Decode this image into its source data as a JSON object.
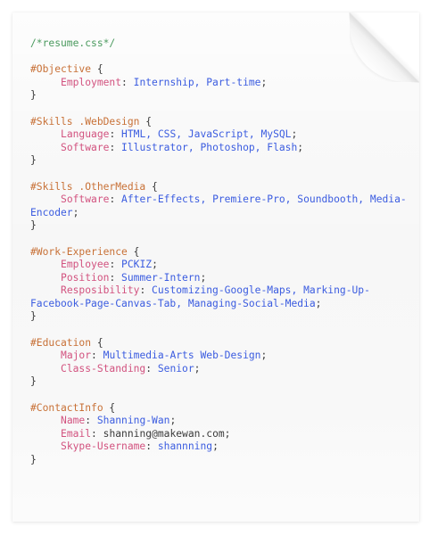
{
  "document": {
    "kind": "css-resume-page",
    "colors": {
      "page_background": "#f7f7f7",
      "canvas_background": "#ffffff",
      "comment": "#4a9a5e",
      "selector": "#c87137",
      "property": "#d2527f",
      "value": "#3b5ce0",
      "punctuation": "#3a3a3a"
    },
    "comment": "/*resume.css*/",
    "open_brace": "{",
    "close_brace": "}",
    "colon": ": ",
    "semicolon": ";",
    "rules": [
      {
        "selector": "#Objective",
        "declarations": [
          {
            "property": "Employment",
            "value": "Internship, Part-time",
            "value_style": "value"
          }
        ]
      },
      {
        "selector": "#Skills .WebDesign",
        "declarations": [
          {
            "property": "Language",
            "value": "HTML, CSS, JavaScript, MySQL",
            "value_style": "value"
          },
          {
            "property": "Software",
            "value": "Illustrator, Photoshop, Flash",
            "value_style": "value"
          }
        ]
      },
      {
        "selector": "#Skills .OtherMedia",
        "declarations": [
          {
            "property": "Software",
            "value": "After-Effects, Premiere-Pro, Soundbooth, Media-Encoder",
            "value_style": "value"
          }
        ]
      },
      {
        "selector": "#Work-Experience",
        "declarations": [
          {
            "property": "Employee",
            "value": "PCKIZ",
            "value_style": "value"
          },
          {
            "property": "Position",
            "value": "Summer-Intern",
            "value_style": "value"
          },
          {
            "property": "Resposibility",
            "value": "Customizing-Google-Maps, Marking-Up-Facebook-Page-Canvas-Tab, Managing-Social-Media",
            "value_style": "value"
          }
        ]
      },
      {
        "selector": "#Education",
        "declarations": [
          {
            "property": "Major",
            "value": "Multimedia-Arts Web-Design",
            "value_style": "value"
          },
          {
            "property": "Class-Standing",
            "value": "Senior",
            "value_style": "value"
          }
        ]
      },
      {
        "selector": "#ContactInfo",
        "declarations": [
          {
            "property": "Name",
            "value": "Shanning-Wan",
            "value_style": "value"
          },
          {
            "property": "Email",
            "value": "shanning@makewan.com",
            "value_style": "plain"
          },
          {
            "property": "Skype-Username",
            "value": "shannning",
            "value_style": "value"
          }
        ]
      }
    ]
  }
}
